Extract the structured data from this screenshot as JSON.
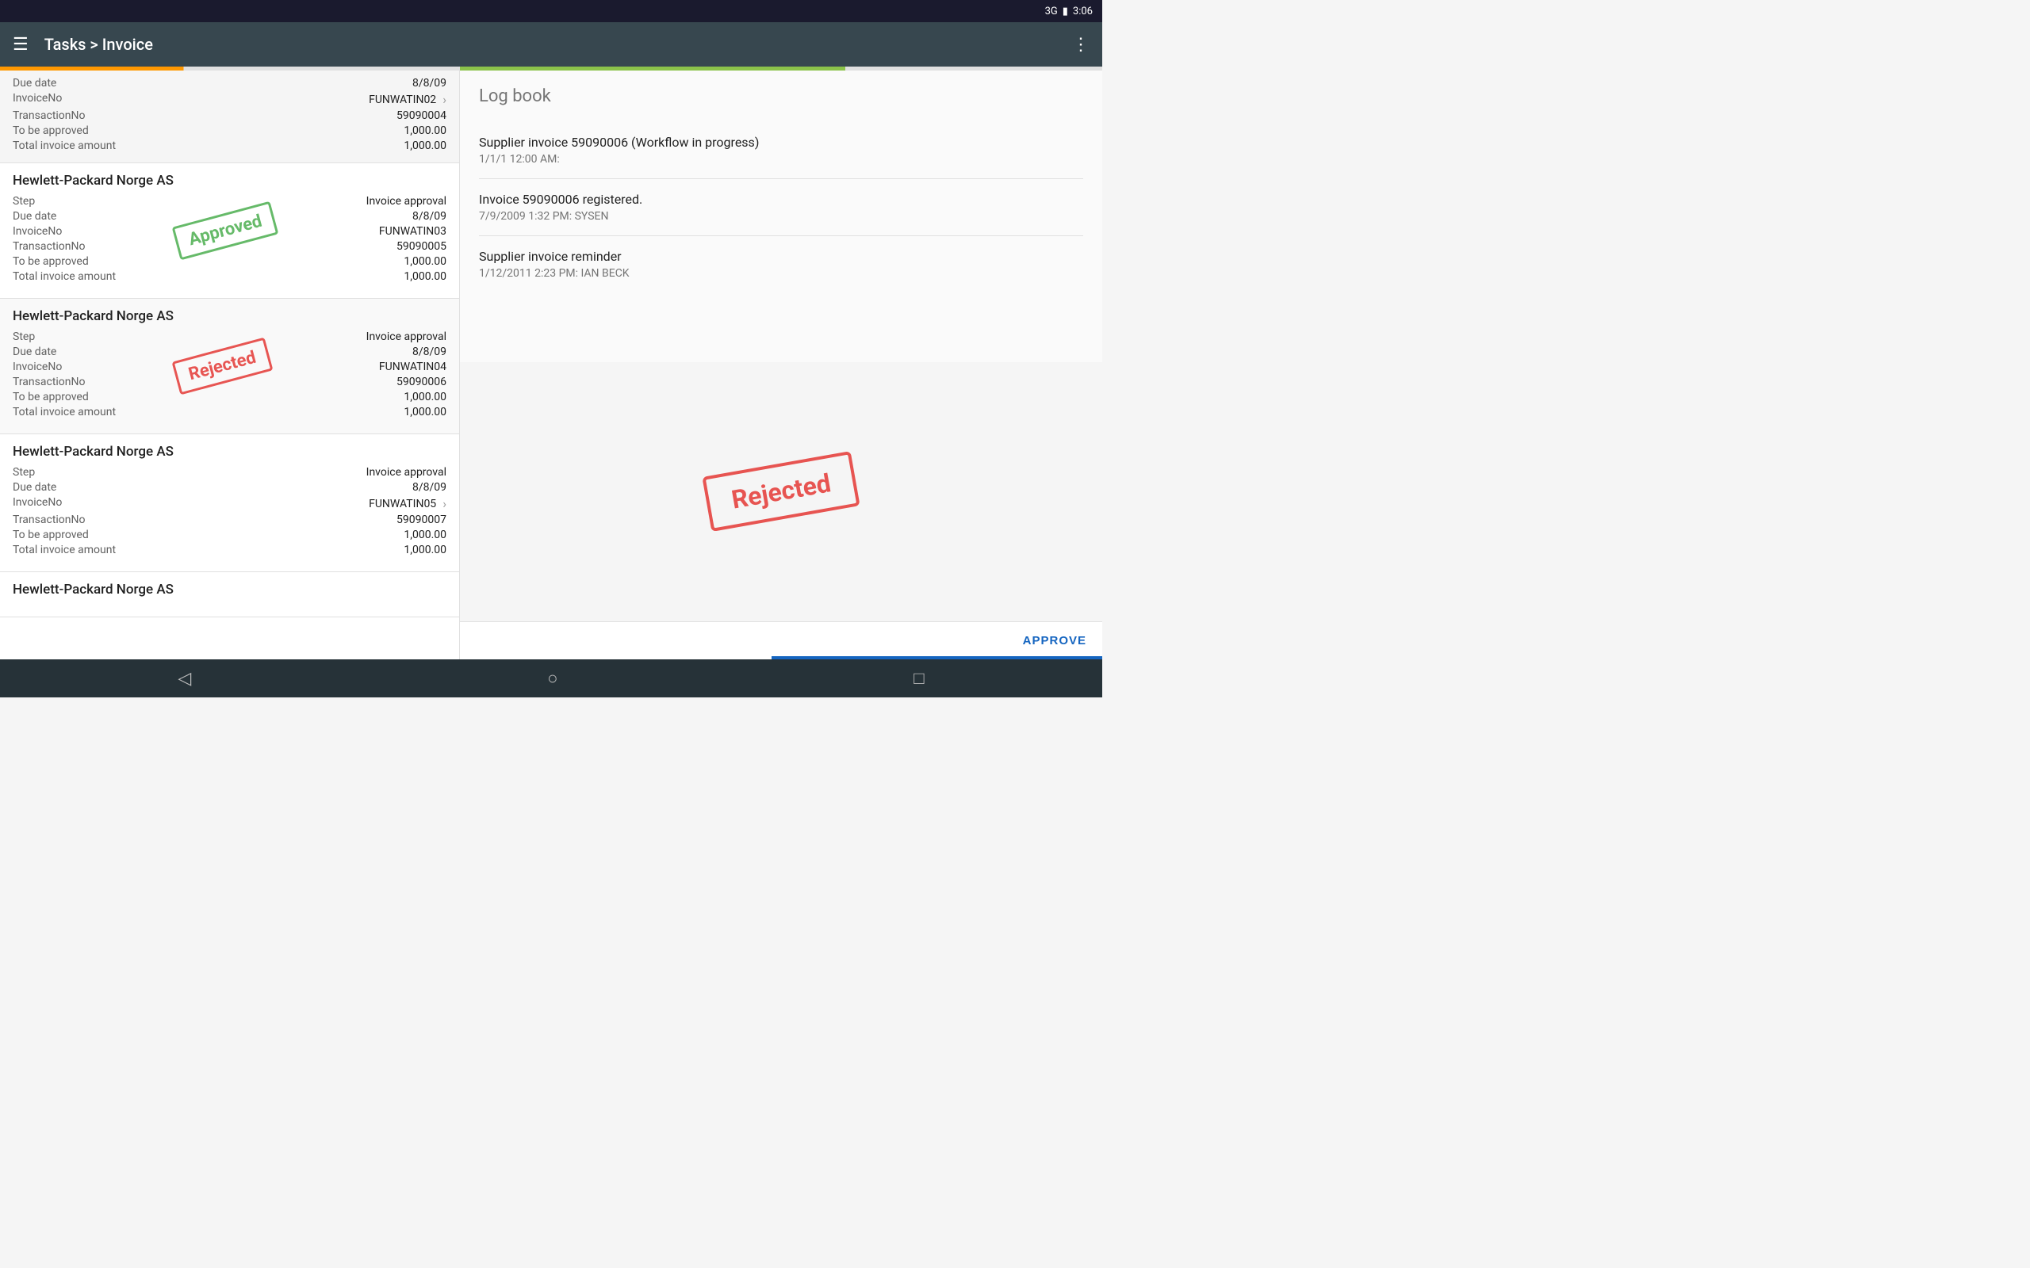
{
  "statusBar": {
    "signal": "3G",
    "battery": "🔋",
    "time": "3:06"
  },
  "appBar": {
    "title": "Tasks > Invoice",
    "menuIcon": "☰",
    "moreIcon": "⋮"
  },
  "leftPanel": {
    "truncatedCard": {
      "dueDate": {
        "label": "Due date",
        "value": "8/8/09"
      },
      "invoiceNo": {
        "label": "InvoiceNo",
        "value": "FUNWATIN02",
        "hasChevron": true
      },
      "transactionNo": {
        "label": "TransactionNo",
        "value": "59090004"
      },
      "toBeApproved": {
        "label": "To be approved",
        "value": "1,000.00"
      },
      "totalInvoiceAmount": {
        "label": "Total invoice amount",
        "value": "1,000.00"
      }
    },
    "cards": [
      {
        "id": "card1",
        "company": "Hewlett-Packard Norge AS",
        "stamp": "Approved",
        "stampType": "approved",
        "fields": [
          {
            "label": "Step",
            "value": "Invoice approval"
          },
          {
            "label": "Due date",
            "value": "8/8/09"
          },
          {
            "label": "InvoiceNo",
            "value": "FUNWATIN03"
          },
          {
            "label": "TransactionNo",
            "value": "59090005"
          },
          {
            "label": "To be approved",
            "value": "1,000.00"
          },
          {
            "label": "Total invoice amount",
            "value": "1,000.00"
          }
        ]
      },
      {
        "id": "card2",
        "company": "Hewlett-Packard Norge AS",
        "stamp": "Rejected",
        "stampType": "rejected",
        "selected": true,
        "fields": [
          {
            "label": "Step",
            "value": "Invoice approval"
          },
          {
            "label": "Due date",
            "value": "8/8/09"
          },
          {
            "label": "InvoiceNo",
            "value": "FUNWATIN04"
          },
          {
            "label": "TransactionNo",
            "value": "59090006"
          },
          {
            "label": "To be approved",
            "value": "1,000.00"
          },
          {
            "label": "Total invoice amount",
            "value": "1,000.00"
          }
        ]
      },
      {
        "id": "card3",
        "company": "Hewlett-Packard Norge AS",
        "stamp": null,
        "fields": [
          {
            "label": "Step",
            "value": "Invoice approval"
          },
          {
            "label": "Due date",
            "value": "8/8/09"
          },
          {
            "label": "InvoiceNo",
            "value": "FUNWATIN05",
            "hasChevron": true
          },
          {
            "label": "TransactionNo",
            "value": "59090007"
          },
          {
            "label": "To be approved",
            "value": "1,000.00"
          },
          {
            "label": "Total invoice amount",
            "value": "1,000.00"
          }
        ]
      },
      {
        "id": "card4",
        "company": "Hewlett-Packard Norge AS",
        "stamp": null,
        "fields": []
      }
    ]
  },
  "rightPanel": {
    "logBook": {
      "title": "Log book",
      "entries": [
        {
          "title": "Supplier invoice 59090006 (Workflow in progress)",
          "subtitle": "1/1/1 12:00 AM:"
        },
        {
          "title": "Invoice 59090006 registered.",
          "subtitle": "7/9/2009 1:32 PM: SYSEN"
        },
        {
          "title": "Supplier invoice reminder",
          "subtitle": "1/12/2011 2:23 PM: IAN BECK"
        }
      ]
    },
    "rejectedStamp": "Rejected",
    "approveButton": "APPROVE"
  },
  "navBar": {
    "back": "◁",
    "home": "○",
    "square": "□"
  }
}
